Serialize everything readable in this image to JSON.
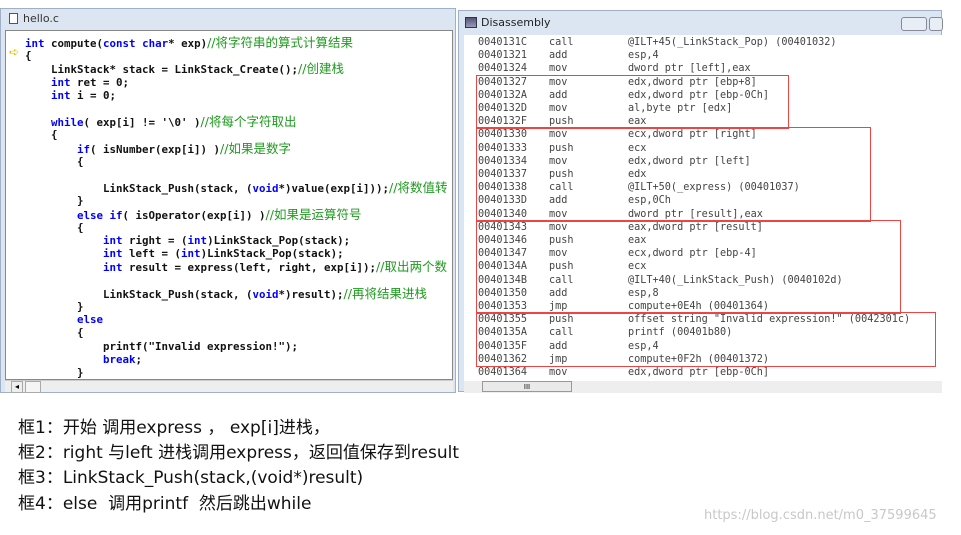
{
  "editor": {
    "title": "hello.c",
    "lines": [
      [
        [
          "kw",
          "int"
        ],
        [
          "t",
          " compute("
        ],
        [
          "kw",
          "const"
        ],
        [
          "t",
          " "
        ],
        [
          "kw",
          "char"
        ],
        [
          "t",
          "* exp)"
        ],
        [
          "cm",
          "//将字符串的算式计算结果"
        ]
      ],
      [
        [
          "t",
          "{"
        ]
      ],
      [
        [
          "t",
          "    LinkStack* stack = LinkStack_Create();"
        ],
        [
          "cm",
          "//创建栈"
        ]
      ],
      [
        [
          "t",
          "    "
        ],
        [
          "kw",
          "int"
        ],
        [
          "t",
          " ret = 0;"
        ]
      ],
      [
        [
          "t",
          "    "
        ],
        [
          "kw",
          "int"
        ],
        [
          "t",
          " i = 0;"
        ]
      ],
      [],
      [
        [
          "t",
          "    "
        ],
        [
          "kw",
          "while"
        ],
        [
          "t",
          "( exp[i] != '\\0' )"
        ],
        [
          "cm",
          "//将每个字符取出"
        ]
      ],
      [
        [
          "t",
          "    {"
        ]
      ],
      [
        [
          "t",
          "        "
        ],
        [
          "kw",
          "if"
        ],
        [
          "t",
          "( isNumber(exp[i]) )"
        ],
        [
          "cm",
          "//如果是数字"
        ]
      ],
      [
        [
          "t",
          "        {"
        ]
      ],
      [],
      [
        [
          "t",
          "            LinkStack_Push(stack, ("
        ],
        [
          "kw",
          "void"
        ],
        [
          "t",
          "*)value(exp[i]));"
        ],
        [
          "cm",
          "//将数值转"
        ]
      ],
      [
        [
          "t",
          "        }"
        ]
      ],
      [
        [
          "t",
          "        "
        ],
        [
          "kw",
          "else if"
        ],
        [
          "t",
          "( isOperator(exp[i]) )"
        ],
        [
          "cm",
          "//如果是运算符号"
        ]
      ],
      [
        [
          "t",
          "        {"
        ]
      ],
      [
        [
          "t",
          "            "
        ],
        [
          "kw",
          "int"
        ],
        [
          "t",
          " right = ("
        ],
        [
          "kw",
          "int"
        ],
        [
          "t",
          ")LinkStack_Pop(stack);"
        ]
      ],
      [
        [
          "t",
          "            "
        ],
        [
          "kw",
          "int"
        ],
        [
          "t",
          " left = ("
        ],
        [
          "kw",
          "int"
        ],
        [
          "t",
          ")LinkStack_Pop(stack);"
        ]
      ],
      [
        [
          "t",
          "            "
        ],
        [
          "kw",
          "int"
        ],
        [
          "t",
          " result = express(left, right, exp[i]);"
        ],
        [
          "cm",
          "//取出两个数"
        ]
      ],
      [],
      [
        [
          "t",
          "            LinkStack_Push(stack, ("
        ],
        [
          "kw",
          "void"
        ],
        [
          "t",
          "*)result);"
        ],
        [
          "cm",
          "//再将结果进栈"
        ]
      ],
      [
        [
          "t",
          "        }"
        ]
      ],
      [
        [
          "t",
          "        "
        ],
        [
          "kw",
          "else"
        ]
      ],
      [
        [
          "t",
          "        {"
        ]
      ],
      [
        [
          "t",
          "            printf(\"Invalid expression!\");"
        ]
      ],
      [
        [
          "t",
          "            "
        ],
        [
          "kw",
          "break"
        ],
        [
          "t",
          ";"
        ]
      ],
      [
        [
          "t",
          "        }"
        ]
      ]
    ],
    "comment_color": "#1e9a1e",
    "keyword_color": "#0000ff"
  },
  "disassembly": {
    "title": "Disassembly",
    "rows": [
      [
        "0040131C",
        "call",
        "@ILT+45(_LinkStack_Pop) (00401032)"
      ],
      [
        "00401321",
        "add",
        "esp,4"
      ],
      [
        "00401324",
        "mov",
        "dword ptr [left],eax"
      ],
      [
        "00401327",
        "mov",
        "edx,dword ptr [ebp+8]"
      ],
      [
        "0040132A",
        "add",
        "edx,dword ptr [ebp-0Ch]"
      ],
      [
        "0040132D",
        "mov",
        "al,byte ptr [edx]"
      ],
      [
        "0040132F",
        "push",
        "eax"
      ],
      [
        "00401330",
        "mov",
        "ecx,dword ptr [right]"
      ],
      [
        "00401333",
        "push",
        "ecx"
      ],
      [
        "00401334",
        "mov",
        "edx,dword ptr [left]"
      ],
      [
        "00401337",
        "push",
        "edx"
      ],
      [
        "00401338",
        "call",
        "@ILT+50(_express) (00401037)"
      ],
      [
        "0040133D",
        "add",
        "esp,0Ch"
      ],
      [
        "00401340",
        "mov",
        "dword ptr [result],eax"
      ],
      [
        "00401343",
        "mov",
        "eax,dword ptr [result]"
      ],
      [
        "00401346",
        "push",
        "eax"
      ],
      [
        "00401347",
        "mov",
        "ecx,dword ptr [ebp-4]"
      ],
      [
        "0040134A",
        "push",
        "ecx"
      ],
      [
        "0040134B",
        "call",
        "@ILT+40(_LinkStack_Push) (0040102d)"
      ],
      [
        "00401350",
        "add",
        "esp,8"
      ],
      [
        "00401353",
        "jmp",
        "compute+0E4h (00401364)"
      ],
      [
        "00401355",
        "push",
        "offset string \"Invalid expression!\" (0042301c)"
      ],
      [
        "0040135A",
        "call",
        "printf (00401b80)"
      ],
      [
        "0040135F",
        "add",
        "esp,4"
      ],
      [
        "00401362",
        "jmp",
        "compute+0F2h (00401372)"
      ],
      [
        "00401364",
        "mov",
        "edx,dword ptr [ebp-0Ch]"
      ]
    ],
    "highlight_color": "#ee4444"
  },
  "notes": [
    "框1：开始 调用express ， exp[i]进栈，",
    "框2：right 与left 进栈调用express，返回值保存到result",
    "框3：LinkStack_Push(stack,(void*)result)",
    "框4：else  调用printf  然后跳出while"
  ],
  "watermark": "https://blog.csdn.net/m0_37599645"
}
